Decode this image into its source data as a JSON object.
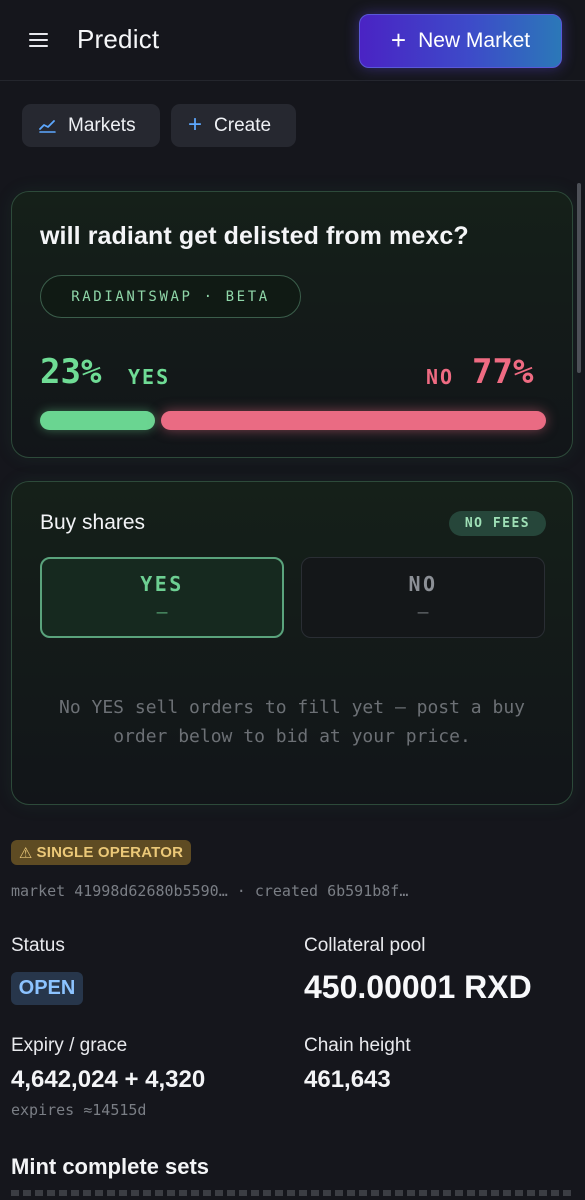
{
  "header": {
    "title": "Predict",
    "new_market_label": "New Market"
  },
  "nav": {
    "markets_label": "Markets",
    "create_label": "Create"
  },
  "market": {
    "question": "will radiant get delisted from mexc?",
    "tag": "RADIANTSWAP · BETA",
    "yes_percent": "23%",
    "yes_label": "YES",
    "no_label": "NO",
    "no_percent": "77%",
    "yes_fraction": 0.23
  },
  "buy": {
    "title": "Buy shares",
    "fees_badge": "NO FEES",
    "yes_option": "YES",
    "yes_value": "—",
    "no_option": "NO",
    "no_value": "—",
    "empty_message": "No YES sell orders to fill yet — post a buy order below to bid at your price."
  },
  "operator_badge": "SINGLE OPERATOR",
  "meta_line": "market 41998d62680b5590… · created 6b591b8f…",
  "details": {
    "status_label": "Status",
    "status_value": "OPEN",
    "pool_label": "Collateral pool",
    "pool_value": "450.00001 RXD",
    "expiry_label": "Expiry / grace",
    "expiry_value": "4,642,024 + 4,320",
    "expiry_sub": "expires ≈14515d",
    "height_label": "Chain height",
    "height_value": "461,643"
  },
  "mint_section_title": "Mint complete sets",
  "colors": {
    "yes": "#6ad591",
    "no": "#ea6b83",
    "accent": "#4a23c4"
  }
}
